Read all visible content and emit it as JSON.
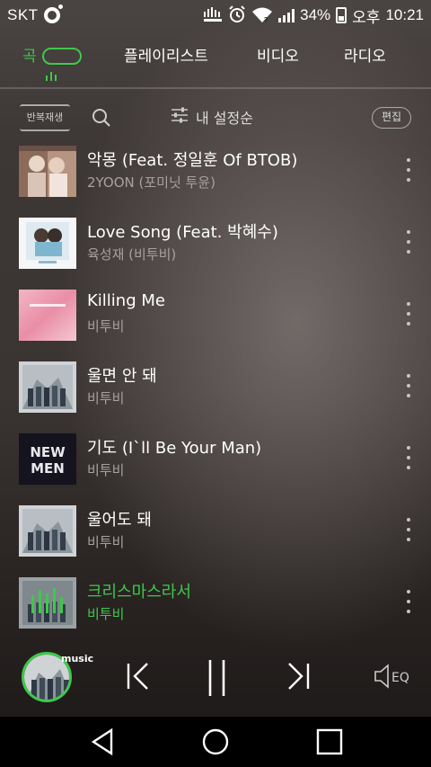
{
  "status_bar": {
    "carrier": "SKT",
    "battery": "34%",
    "ampm": "오후",
    "time": "10:21"
  },
  "tabs": {
    "songs": "곡",
    "playlist": "플레이리스트",
    "video": "비디오",
    "radio": "라디오"
  },
  "toolbar": {
    "repeat_label": "반복재생",
    "sort_label": "내 설정순",
    "edit_label": "편집"
  },
  "songs": [
    {
      "title": "악몽 (Feat. 정일훈 Of BTOB)",
      "artist": "2YOON (포미닛 투윤)"
    },
    {
      "title": "Love Song (Feat. 박혜수)",
      "artist": "육성재 (비투비)"
    },
    {
      "title": "Killing Me",
      "artist": "비투비"
    },
    {
      "title": "울면 안 돼",
      "artist": "비투비"
    },
    {
      "title": "기도 (I`ll Be Your Man)",
      "artist": "비투비"
    },
    {
      "title": "울어도 돼",
      "artist": "비투비"
    },
    {
      "title": "크리스마스라서",
      "artist": "비투비"
    }
  ],
  "album_text": {
    "new_men_top": "NEW",
    "new_men_bottom": "MEN"
  },
  "player": {
    "label": "music",
    "eq_label": "EQ"
  },
  "colors": {
    "accent": "#3ec94a",
    "subtext": "#a6a09e"
  }
}
